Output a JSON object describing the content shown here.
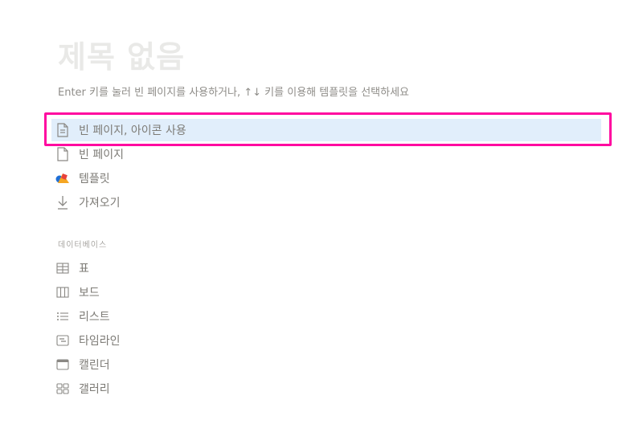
{
  "page": {
    "title": "제목 없음",
    "hint": "Enter 키를 눌러 빈 페이지를 사용하거나, ↑↓ 키를 이용해 템플릿을 선택하세요"
  },
  "menu": {
    "items": [
      {
        "label": "빈 페이지, 아이콘 사용",
        "icon": "page-with-icon-icon",
        "selected": true
      },
      {
        "label": "빈 페이지",
        "icon": "blank-page-icon"
      },
      {
        "label": "템플릿",
        "icon": "templates-icon"
      },
      {
        "label": "가져오기",
        "icon": "import-arrow-icon"
      }
    ]
  },
  "database": {
    "section_label": "데이터베이스",
    "items": [
      {
        "label": "표",
        "icon": "table-icon"
      },
      {
        "label": "보드",
        "icon": "board-icon"
      },
      {
        "label": "리스트",
        "icon": "list-icon"
      },
      {
        "label": "타임라인",
        "icon": "timeline-icon"
      },
      {
        "label": "캘린더",
        "icon": "calendar-icon"
      },
      {
        "label": "갤러리",
        "icon": "gallery-icon"
      }
    ]
  },
  "colors": {
    "highlight_border": "#ff0aa0",
    "selected_bg": "#e1eefb",
    "title": "#e9e9e7"
  }
}
